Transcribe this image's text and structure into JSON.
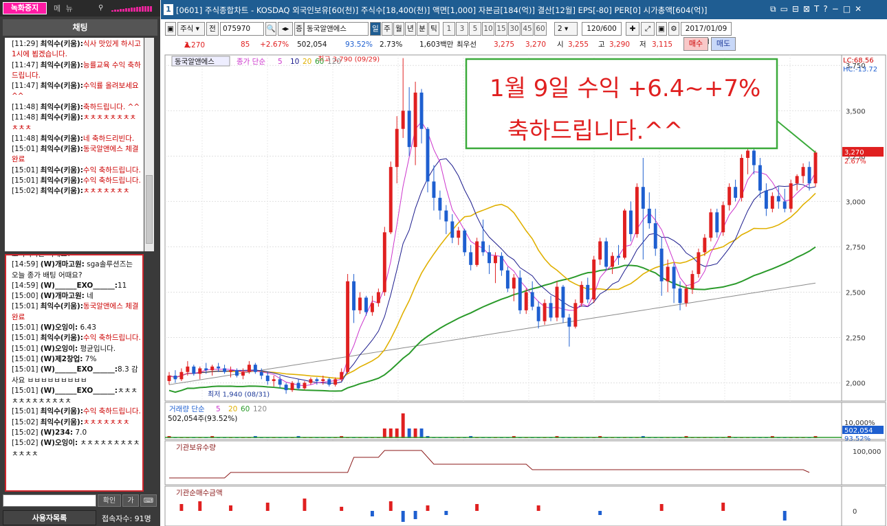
{
  "left": {
    "record_button": "녹화중지",
    "menu_text": "메 뉴",
    "chat_header": "채팅",
    "chat_messages": [
      {
        "time": "[11:29]",
        "user": "최익수(키움):",
        "text": "식사 맛있게 하시고 1시에 뵙겠습니다.",
        "color": "red"
      },
      {
        "time": "[11:47]",
        "user": "최익수(키움):",
        "text": "능률교육 수익 축하드립니다.",
        "color": "red"
      },
      {
        "time": "[11:47]",
        "user": "최익수(키움):",
        "text": "수익률 올려보세요 ^^",
        "color": "red"
      },
      {
        "time": "[11:48]",
        "user": "최익수(키움):",
        "text": "축하드립니다. ^^",
        "color": "red"
      },
      {
        "time": "[11:48]",
        "user": "최익수(키움):",
        "text": "ㅊㅊㅊㅊㅊㅊㅊㅊㅊㅊㅊ",
        "color": "red"
      },
      {
        "time": "[11:48]",
        "user": "최익수(키움):",
        "text": "네 축하드리빈다.",
        "color": "red"
      },
      {
        "time": "[15:01]",
        "user": "최익수(키움):",
        "text": "동국알앤에스 체결완료",
        "color": "red"
      },
      {
        "time": "[15:01]",
        "user": "최익수(키움):",
        "text": "수익 축하드립니다.",
        "color": "red"
      },
      {
        "time": "[15:01]",
        "user": "최익수(키움):",
        "text": "수익 축하드립니다.",
        "color": "red"
      },
      {
        "time": "[15:02]",
        "user": "최익수(키움):",
        "text": "ㅊㅊㅊㅊㅊㅊㅊ",
        "color": "red"
      }
    ],
    "public_partial": "오더리자는 어때요?",
    "public_messages": [
      {
        "time": "[14:59]",
        "user": "(W)개마고원:",
        "text": " sga솔루션즈는 오늘 종가 배팅 어때요?",
        "color": "blk"
      },
      {
        "time": "[14:59]",
        "user": "(W)______EXO______:",
        "text": "11",
        "color": "blk"
      },
      {
        "time": "[15:00]",
        "user": "(W)개마고원:",
        "text": " 네",
        "color": "blk"
      },
      {
        "time": "[15:01]",
        "user": "최익수(키움):",
        "text": "동국알앤에스 체결완료",
        "color": "red"
      },
      {
        "time": "[15:01]",
        "user": "(W)오잉이:",
        "text": " 6.43",
        "color": "blk"
      },
      {
        "time": "[15:01]",
        "user": "최익수(키움):",
        "text": "수익 축하드립니다.",
        "color": "red"
      },
      {
        "time": "[15:01]",
        "user": "(W)오잉이:",
        "text": " 평균입니다.",
        "color": "blk"
      },
      {
        "time": "[15:01]",
        "user": "(W)제2창업:",
        "text": " 7%",
        "color": "blk"
      },
      {
        "time": "[15:01]",
        "user": "(W)______EXO______:",
        "text": "8.3 감사요 ㅂㅂㅂㅂㅂㅂㅂㅂㅂ",
        "color": "blk"
      },
      {
        "time": "[15:01]",
        "user": "(W)______EXO______:",
        "text": "ㅊㅊㅊㅊㅊㅊㅊㅊㅊㅊㅊㅊ",
        "color": "blk"
      },
      {
        "time": "[15:01]",
        "user": "최익수(키움):",
        "text": "수익 축하드립니다.",
        "color": "red"
      },
      {
        "time": "[15:02]",
        "user": "최익수(키움):",
        "text": "ㅊㅊㅊㅊㅊㅊㅊ",
        "color": "red"
      },
      {
        "time": "[15:02]",
        "user": "(W)234:",
        "text": " 7.0",
        "color": "blk"
      },
      {
        "time": "[15:02]",
        "user": "(W)오잉이:",
        "text": " ㅊㅊㅊㅊㅊㅊㅊㅊㅊㅊㅊㅊㅊ",
        "color": "blk"
      }
    ],
    "confirm_btn": "확인",
    "font_btn": "가",
    "users_btn": "사용자목록",
    "users_count": "접속자수: 91명"
  },
  "window": {
    "num": "1",
    "title": "[0601] 주식종합차트 - KOSDAQ 외국인보유[60(천)] 주식수[18,400(천)] 액면[1,000] 자본금[184(억)] 결산[12월] EPS[-80] PER[0] 시가총액[604(억)]",
    "title_icons": [
      "⧉",
      "▭",
      "⊟",
      "⊠",
      "T",
      "?",
      "−",
      "□",
      "✕"
    ]
  },
  "toolbar": {
    "type_select": "주식",
    "jeon": "전",
    "code": "075970",
    "stock_name": "동국알앤에스",
    "periods": [
      "일",
      "주",
      "월",
      "년",
      "분",
      "틱"
    ],
    "minutes": [
      "1",
      "3",
      "5",
      "10",
      "15",
      "30",
      "45",
      "60"
    ],
    "select_val": "2",
    "count": "120/600",
    "date": "2017/01/09"
  },
  "price": {
    "price": "3,270",
    "change": "85",
    "pct": "+2.67%",
    "volume": "502,054",
    "vol_pct": "93.52%",
    "turnover": "2.73%",
    "amount": "1,603백만",
    "best": "최우선",
    "bid": "3,275",
    "ask": "3,270",
    "open_lbl": "시",
    "open": "3,255",
    "high_lbl": "고",
    "high": "3,290",
    "low_lbl": "저",
    "low": "3,115",
    "buy": "매수",
    "sell": "매도"
  },
  "chart": {
    "legend_name": "동국알앤에스",
    "legend_type": "종가 단순",
    "ma_labels": [
      "5",
      "10",
      "20",
      "60",
      "120"
    ],
    "lc": "LC:68.56",
    "hc": "HC:-13.72",
    "y_ticks": [
      "3,750",
      "3,500",
      "3,250",
      "3,000",
      "2,750",
      "2,500",
      "2,250",
      "2,000"
    ],
    "cur_price": "3,270",
    "cur_pct": "2.67%",
    "high_label": "최고 3,790 (09/29)",
    "low_label": "최저 1,940 (08/31)",
    "annotation_line1": "1월 9일 수익 +6.4~+7%",
    "annotation_line2": "축하드립니다.^^",
    "vol_legend": "거래량 단순",
    "vol_ma_labels": [
      "5",
      "20",
      "60",
      "120"
    ],
    "vol_value": "502,054주(93.52%)",
    "vol_tick": "10,000%",
    "vol_cur": "502,054",
    "vol_cur_pct": "93.52%",
    "inst_hold": "기관보유수량",
    "inst_hold_tick": "100,000",
    "inst_net": "기관순매수금액",
    "inst_net_tick": "0"
  },
  "colors": {
    "up": "#e02020",
    "down": "#1e5fd0",
    "ma5": "#cc33cc",
    "ma10": "#1a1a8c",
    "ma20": "#e0b000",
    "ma60": "#2a9a2a",
    "ma120": "#8a8a8a",
    "annot": "#e02020",
    "annot_box": "#3aaa3a"
  },
  "chart_data": {
    "type": "candlestick",
    "y_range": [
      1900,
      3800
    ],
    "candles": [
      [
        2010,
        2060,
        1990,
        2040
      ],
      [
        2040,
        2070,
        2000,
        2020
      ],
      [
        2020,
        2080,
        2010,
        2060
      ],
      [
        2060,
        2120,
        2040,
        2090
      ],
      [
        2090,
        2100,
        2040,
        2050
      ],
      [
        2050,
        2090,
        2020,
        2080
      ],
      [
        2080,
        2110,
        2050,
        2070
      ],
      [
        2070,
        2100,
        2040,
        2090
      ],
      [
        2090,
        2110,
        2060,
        2080
      ],
      [
        2080,
        2100,
        2050,
        2060
      ],
      [
        2060,
        2090,
        2030,
        2070
      ],
      [
        2070,
        2080,
        2030,
        2040
      ],
      [
        2040,
        2080,
        2020,
        2060
      ],
      [
        2060,
        2120,
        2050,
        2100
      ],
      [
        2100,
        2110,
        2050,
        2060
      ],
      [
        2060,
        2080,
        2020,
        2040
      ],
      [
        2040,
        2060,
        1990,
        2010
      ],
      [
        2010,
        2040,
        1980,
        2020
      ],
      [
        2020,
        2040,
        1970,
        1990
      ],
      [
        1990,
        2000,
        1940,
        1960
      ],
      [
        1960,
        2010,
        1950,
        2000
      ],
      [
        2000,
        2020,
        1960,
        1970
      ],
      [
        1970,
        2010,
        1960,
        2000
      ],
      [
        2000,
        2030,
        1990,
        2020
      ],
      [
        2020,
        2030,
        1990,
        2010
      ],
      [
        2010,
        2040,
        1990,
        2020
      ],
      [
        2020,
        2030,
        1980,
        1990
      ],
      [
        1990,
        2030,
        1980,
        2020
      ],
      [
        2020,
        2080,
        2010,
        2060
      ],
      [
        2060,
        2600,
        2050,
        2560
      ],
      [
        2560,
        2600,
        2330,
        2400
      ],
      [
        2400,
        2500,
        2380,
        2470
      ],
      [
        2470,
        2480,
        2370,
        2390
      ],
      [
        2390,
        2480,
        2370,
        2440
      ],
      [
        2440,
        2520,
        2420,
        2500
      ],
      [
        2500,
        2860,
        2480,
        2830
      ],
      [
        2830,
        3220,
        2820,
        3190
      ],
      [
        3190,
        3470,
        3100,
        3400
      ],
      [
        3400,
        3790,
        3350,
        3500
      ],
      [
        3500,
        3630,
        3250,
        3300
      ],
      [
        3300,
        3660,
        3200,
        3600
      ],
      [
        3600,
        3620,
        3320,
        3400
      ],
      [
        3400,
        3410,
        3050,
        3110
      ],
      [
        3110,
        3200,
        2950,
        3020
      ],
      [
        3020,
        3060,
        2900,
        2950
      ],
      [
        2950,
        2980,
        2820,
        2890
      ],
      [
        2890,
        2930,
        2770,
        2800
      ],
      [
        2800,
        2860,
        2760,
        2840
      ],
      [
        2840,
        2850,
        2700,
        2720
      ],
      [
        2720,
        2760,
        2620,
        2650
      ],
      [
        2650,
        2800,
        2640,
        2780
      ],
      [
        2780,
        2900,
        2700,
        2720
      ],
      [
        2720,
        2760,
        2600,
        2660
      ],
      [
        2660,
        2720,
        2550,
        2700
      ],
      [
        2700,
        2720,
        2590,
        2620
      ],
      [
        2620,
        2640,
        2500,
        2520
      ],
      [
        2520,
        2600,
        2450,
        2580
      ],
      [
        2580,
        2620,
        2380,
        2400
      ],
      [
        2400,
        2520,
        2380,
        2500
      ],
      [
        2500,
        2560,
        2400,
        2420
      ],
      [
        2420,
        2450,
        2300,
        2340
      ],
      [
        2340,
        2460,
        2320,
        2440
      ],
      [
        2440,
        2480,
        2340,
        2360
      ],
      [
        2360,
        2560,
        2340,
        2530
      ],
      [
        2530,
        2540,
        2330,
        2360
      ],
      [
        2360,
        2380,
        2200,
        2310
      ],
      [
        2310,
        2460,
        2300,
        2440
      ],
      [
        2440,
        2560,
        2420,
        2540
      ],
      [
        2540,
        2580,
        2440,
        2460
      ],
      [
        2460,
        2700,
        2440,
        2680
      ],
      [
        2680,
        2800,
        2650,
        2780
      ],
      [
        2780,
        2800,
        2620,
        2640
      ],
      [
        2640,
        2720,
        2600,
        2700
      ],
      [
        2700,
        2760,
        2650,
        2690
      ],
      [
        2690,
        2960,
        2680,
        2950
      ],
      [
        2950,
        3000,
        2780,
        2820
      ],
      [
        2820,
        3100,
        2800,
        3080
      ],
      [
        3080,
        3240,
        2680,
        2960
      ],
      [
        2960,
        3050,
        2850,
        2880
      ],
      [
        2880,
        2960,
        2700,
        2740
      ],
      [
        2740,
        2800,
        2480,
        2560
      ],
      [
        2560,
        2680,
        2500,
        2640
      ],
      [
        2640,
        2660,
        2440,
        2520
      ],
      [
        2520,
        2560,
        2400,
        2440
      ],
      [
        2440,
        2540,
        2420,
        2520
      ],
      [
        2520,
        2620,
        2490,
        2600
      ],
      [
        2600,
        2740,
        2580,
        2720
      ],
      [
        2720,
        2820,
        2700,
        2800
      ],
      [
        2800,
        2960,
        2780,
        2940
      ],
      [
        2940,
        2960,
        2800,
        2830
      ],
      [
        2830,
        3000,
        2810,
        2980
      ],
      [
        2980,
        3100,
        2950,
        3080
      ],
      [
        3080,
        3120,
        3000,
        3020
      ],
      [
        3020,
        3260,
        3000,
        3240
      ],
      [
        3240,
        3530,
        3150,
        3280
      ],
      [
        3280,
        3360,
        3150,
        3200
      ],
      [
        3200,
        3240,
        3020,
        3060
      ],
      [
        3060,
        3100,
        2920,
        2960
      ],
      [
        2960,
        3050,
        2940,
        3030
      ],
      [
        3030,
        3080,
        2960,
        3000
      ],
      [
        3000,
        3070,
        2940,
        2960
      ],
      [
        2960,
        3120,
        2940,
        3100
      ],
      [
        3100,
        3150,
        3060,
        3140
      ],
      [
        3140,
        3210,
        3100,
        3190
      ],
      [
        3190,
        3220,
        3060,
        3100
      ],
      [
        3100,
        3280,
        3080,
        3270
      ]
    ]
  }
}
